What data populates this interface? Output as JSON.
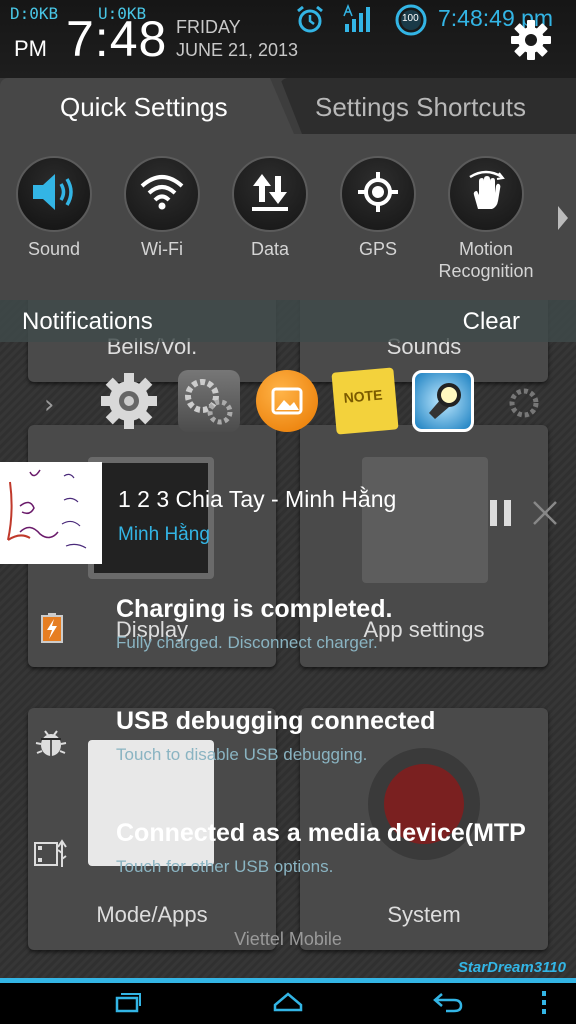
{
  "status_bar": {
    "net_down": "D:0KB",
    "net_up": "U:0KB",
    "ampm": "PM",
    "big_clock": "7:48",
    "day": "FRIDAY",
    "date": "JUNE 21, 2013",
    "time": "7:48:49 pm",
    "battery_level_text": "100",
    "icons": [
      "alarm-icon",
      "signal-icon",
      "battery-icon",
      "settings-gear-icon"
    ]
  },
  "quick_settings": {
    "tabs": [
      {
        "label": "Quick Settings",
        "active": true
      },
      {
        "label": "Settings Shortcuts",
        "active": false
      }
    ],
    "toggles": [
      {
        "label": "Sound",
        "icon": "speaker-icon",
        "active": true
      },
      {
        "label": "Wi-Fi",
        "icon": "wifi-icon",
        "active": false
      },
      {
        "label": "Data",
        "icon": "data-arrows-icon",
        "active": false
      },
      {
        "label": "GPS",
        "icon": "gps-icon",
        "active": false
      },
      {
        "label": "Motion Recognition",
        "icon": "motion-hand-icon",
        "active": false
      }
    ]
  },
  "notifications": {
    "header": "Notifications",
    "clear_label": "Clear",
    "music": {
      "title": "1 2 3 Chia Tay - Minh Hằng",
      "artist": "Minh Hằng"
    },
    "items": [
      {
        "title": "Charging is completed.",
        "subtitle": "Fully charged. Disconnect charger.",
        "icon": "battery-charging-icon"
      },
      {
        "title": "USB debugging connected",
        "subtitle": "Touch to disable USB debugging.",
        "icon": "android-bug-icon"
      },
      {
        "title": "Connected as a media device(MTP",
        "subtitle": "Touch for other USB options.",
        "icon": "usb-media-icon"
      }
    ],
    "carrier": "Viettel Mobile",
    "brand": "StarDream3110"
  },
  "background_app": {
    "tiles": [
      "Bells/Vol.",
      "Sounds",
      "Display",
      "App settings",
      "Mode/Apps",
      "System"
    ]
  },
  "colors": {
    "accent": "#33b5e5",
    "panel": "#474747",
    "sound_active": "#33b5e5"
  }
}
